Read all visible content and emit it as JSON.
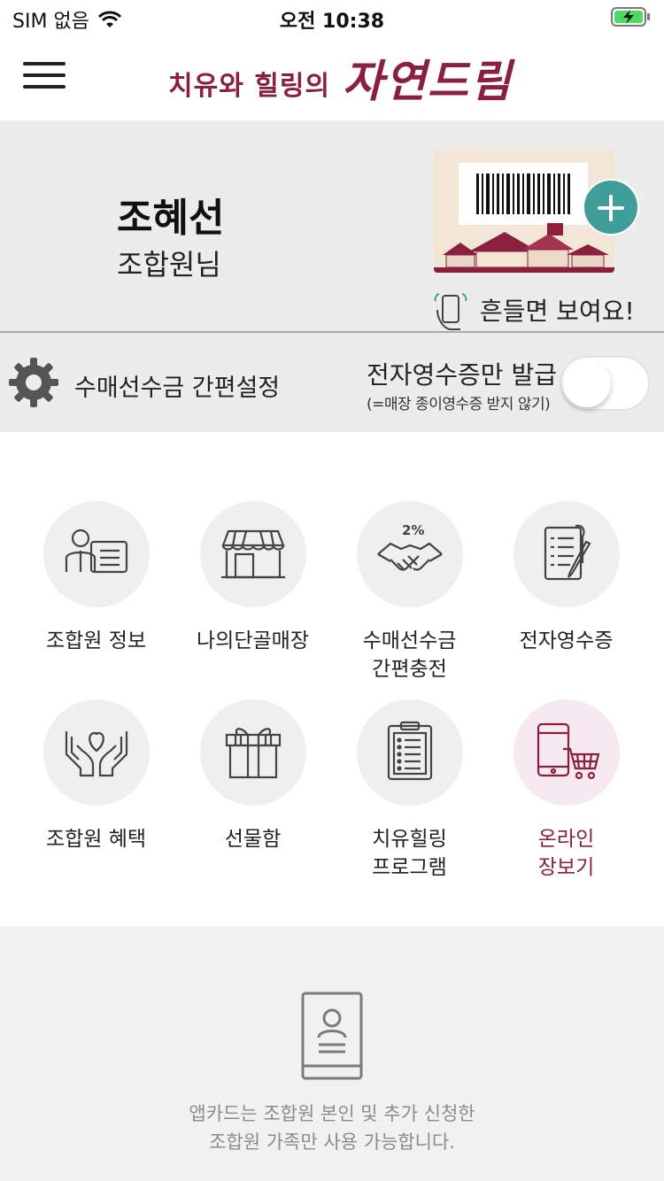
{
  "status_bar": {
    "carrier": "SIM 없음",
    "time": "오전 10:38"
  },
  "header": {
    "logo_sub": "치유와 힐링의",
    "logo_main": "자연드림",
    "menu_icon": "hamburger-icon"
  },
  "member": {
    "name": "조혜선",
    "role": "조합원님",
    "shake_text": "흔들면 보여요!"
  },
  "settings": {
    "quick_setting_label": "수매선수금 간편설정",
    "receipt_title": "전자영수증만 발급",
    "receipt_sub": "(=매장 종이영수증 받지 않기)",
    "receipt_toggle_on": false
  },
  "menu": {
    "items": [
      {
        "label": "조합원 정보",
        "icon": "member-info-icon",
        "highlight": false
      },
      {
        "label": "나의단골매장",
        "icon": "store-icon",
        "highlight": false
      },
      {
        "label": "수매선수금\n간편충전",
        "icon": "handshake-icon",
        "badge": "2%",
        "highlight": false
      },
      {
        "label": "전자영수증",
        "icon": "receipt-icon",
        "highlight": false
      },
      {
        "label": "조합원 혜택",
        "icon": "heart-hands-icon",
        "highlight": false
      },
      {
        "label": "선물함",
        "icon": "gift-box-icon",
        "highlight": false
      },
      {
        "label": "치유힐링\n프로그램",
        "icon": "clipboard-icon",
        "highlight": false
      },
      {
        "label": "온라인\n장보기",
        "icon": "online-shopping-icon",
        "highlight": true
      }
    ]
  },
  "footer": {
    "notice": "앱카드는 조합원 본인 및 추가 신청한\n조합원 가족만 사용 가능합니다."
  },
  "colors": {
    "brand": "#8a1f3e",
    "accent_teal": "#3f9d9a",
    "panel_bg": "#ececec",
    "icon_stroke": "#444444"
  }
}
